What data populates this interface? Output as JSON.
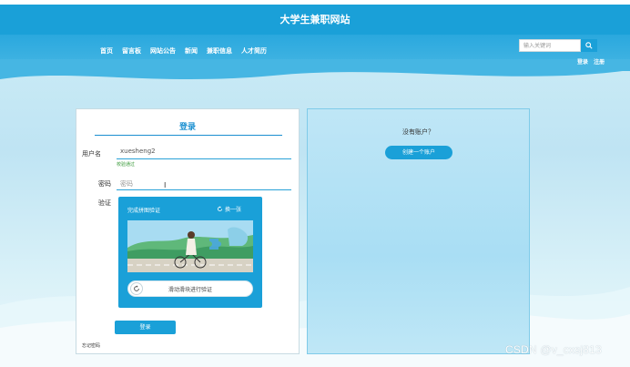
{
  "header": {
    "site_title": "大学生兼职网站",
    "nav": [
      "首页",
      "留言板",
      "网站公告",
      "新闻",
      "兼职信息",
      "人才简历"
    ],
    "search_placeholder": "输入关键词",
    "login_link": "登录",
    "register_link": "注册"
  },
  "login": {
    "title": "登录",
    "username_label": "用户名",
    "username_value": "xuesheng2",
    "username_hint": "校验通过",
    "password_label": "密码",
    "password_value": "密码",
    "captcha_label": "验证",
    "captcha_heading": "完成拼图验证",
    "captcha_refresh": "换一张",
    "slider_text": "滑动滑块进行验证",
    "submit_label": "登录",
    "forgot_label": "忘记密码"
  },
  "register": {
    "prompt": "没有账户？",
    "create_label": "创建一个账户"
  },
  "watermark": "CSDN @v_cxsj813",
  "colors": {
    "primary": "#1aa0d8",
    "nav_band": "#2aa8de",
    "hint_ok": "#3a9a3a"
  },
  "icons": {
    "search": "search-icon",
    "refresh": "refresh-icon",
    "slider": "rotate-arrow-icon"
  }
}
